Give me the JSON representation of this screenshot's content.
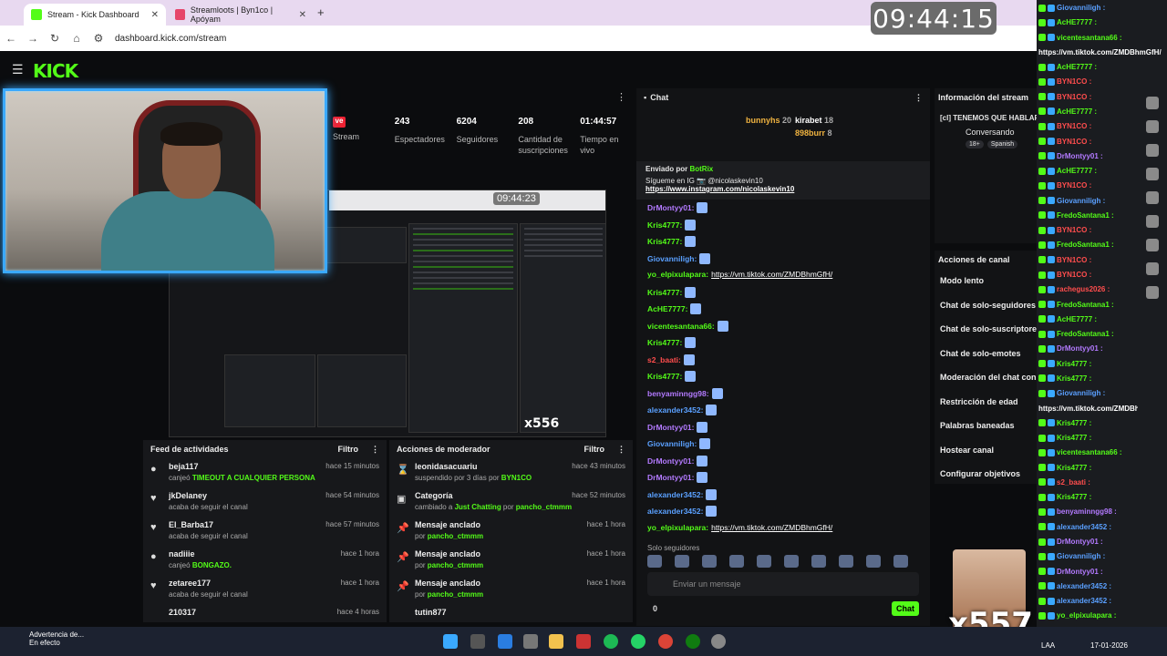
{
  "browser": {
    "tabs": [
      {
        "label": "Stream - Kick Dashboard",
        "active": true
      },
      {
        "label": "Streamloots | Byn1co | Apóyam",
        "active": false
      }
    ],
    "url": "dashboard.kick.com/stream",
    "new_tab": "+"
  },
  "clock": "09:44:15",
  "app": {
    "logo": "KICK"
  },
  "stats": [
    {
      "value": "",
      "label": "Stream",
      "highlight": "ve"
    },
    {
      "value": "243",
      "label": "Espectadores"
    },
    {
      "value": "6204",
      "label": "Seguidores"
    },
    {
      "value": "208",
      "label": "Cantidad de suscripciones"
    },
    {
      "value": "01:44:57",
      "label": "Tiempo en vivo"
    }
  ],
  "preview": {
    "clock": "09:44:23",
    "overlay_count": "x556"
  },
  "feed": {
    "title": "Feed de actividades",
    "filter": "Filtro",
    "items": [
      {
        "name": "beja117",
        "desc": "canjeó",
        "extra": "TIMEOUT A CUALQUIER PERSONA",
        "time": "hace 15 minutos",
        "icon": "redeem"
      },
      {
        "name": "jkDelaney",
        "desc": "acaba de seguir el canal",
        "extra": "",
        "time": "hace 54 minutos",
        "icon": "heart"
      },
      {
        "name": "El_Barba17",
        "desc": "acaba de seguir el canal",
        "extra": "",
        "time": "hace 57 minutos",
        "icon": "heart"
      },
      {
        "name": "nadiiie",
        "desc": "canjeó",
        "extra": "BONGAZO.",
        "time": "hace 1 hora",
        "icon": "redeem"
      },
      {
        "name": "zetaree177",
        "desc": "acaba de seguir el canal",
        "extra": "",
        "time": "hace 1 hora",
        "icon": "heart"
      },
      {
        "name": "210317",
        "desc": "",
        "extra": "",
        "time": "hace 4 horas",
        "icon": "heart"
      }
    ]
  },
  "mod": {
    "title": "Acciones de moderador",
    "filter": "Filtro",
    "items": [
      {
        "name": "leonidasacuariu",
        "desc": "suspendido por 3 días por",
        "extra": "BYN1CO",
        "time": "hace 43 minutos",
        "icon": "hourglass"
      },
      {
        "name": "Categoría",
        "desc": "cambiado a",
        "extra": "Just Chatting",
        "by": "pancho_ctmmm",
        "time": "hace 52 minutos",
        "icon": "folder"
      },
      {
        "name": "Mensaje anclado",
        "desc": "por",
        "extra": "pancho_ctmmm",
        "time": "hace 1 hora",
        "icon": "pin"
      },
      {
        "name": "Mensaje anclado",
        "desc": "por",
        "extra": "pancho_ctmmm",
        "time": "hace 1 hora",
        "icon": "pin"
      },
      {
        "name": "Mensaje anclado",
        "desc": "por",
        "extra": "pancho_ctmmm",
        "time": "hace 1 hora",
        "icon": "pin"
      },
      {
        "name": "tutin877",
        "desc": "",
        "extra": "",
        "time": "",
        "icon": "hourglass"
      }
    ]
  },
  "chat": {
    "title": "Chat",
    "gifters": [
      {
        "name": "bunnyhs",
        "count": "20"
      },
      {
        "name": "kirabet",
        "count": "18"
      },
      {
        "name": "898burr",
        "count": "8"
      }
    ],
    "pinned": {
      "by": "Enviado por",
      "user": "BotRix",
      "text": "Sígueme en IG 📷 @nicolaskevin10",
      "link": "https://www.instagram.com/nicolaskevin10"
    },
    "messages": [
      {
        "user": "DrMontyy01:",
        "color": "#b37aff",
        "text": "",
        "link": ""
      },
      {
        "user": "Kris4777:",
        "color": "#53fc18",
        "text": "",
        "link": ""
      },
      {
        "user": "Kris4777:",
        "color": "#53fc18",
        "text": "",
        "link": ""
      },
      {
        "user": "Giovanniligh:",
        "color": "#5aa0ff",
        "text": "",
        "link": ""
      },
      {
        "user": "yo_elpixulapara:",
        "color": "#53fc18",
        "text": "",
        "link": "https://vm.tiktok.com/ZMDBhmGfH/"
      },
      {
        "user": "Kris4777:",
        "color": "#53fc18",
        "text": "",
        "link": ""
      },
      {
        "user": "AcHE7777:",
        "color": "#53fc18",
        "text": "",
        "link": ""
      },
      {
        "user": "vicentesantana66:",
        "color": "#53fc18",
        "text": "",
        "link": ""
      },
      {
        "user": "Kris4777:",
        "color": "#53fc18",
        "text": "",
        "link": ""
      },
      {
        "user": "s2_baati:",
        "color": "#ff4d4d",
        "text": "",
        "link": ""
      },
      {
        "user": "Kris4777:",
        "color": "#53fc18",
        "text": "",
        "link": ""
      },
      {
        "user": "benyaminngg98:",
        "color": "#b37aff",
        "text": "",
        "link": ""
      },
      {
        "user": "alexander3452:",
        "color": "#5aa0ff",
        "text": "",
        "link": ""
      },
      {
        "user": "DrMontyy01:",
        "color": "#b37aff",
        "text": "",
        "link": ""
      },
      {
        "user": "Giovanniligh:",
        "color": "#5aa0ff",
        "text": "",
        "link": ""
      },
      {
        "user": "DrMontyy01:",
        "color": "#b37aff",
        "text": "",
        "link": ""
      },
      {
        "user": "DrMontyy01:",
        "color": "#b37aff",
        "text": "",
        "link": ""
      },
      {
        "user": "alexander3452:",
        "color": "#5aa0ff",
        "text": "",
        "link": ""
      },
      {
        "user": "alexander3452:",
        "color": "#5aa0ff",
        "text": "",
        "link": ""
      },
      {
        "user": "yo_elpixulapara:",
        "color": "#53fc18",
        "text": "",
        "link": "https://vm.tiktok.com/ZMDBhmGfH/"
      }
    ],
    "solo_label": "Solo seguidores",
    "input_placeholder": "Enviar un mensaje",
    "send_label": "Chat",
    "points": "0"
  },
  "info": {
    "title": "Información del stream",
    "stream_title": "[cl] TENEMOS QUE HABLAR | !ig !casino !ds",
    "category": "Conversando",
    "tags": [
      "18+",
      "Spanish"
    ]
  },
  "actions": {
    "title": "Acciones de canal",
    "items": [
      "Modo lento",
      "Chat de solo-seguidores",
      "Chat de solo-suscriptores",
      "Chat de solo-emotes",
      "Moderación del chat con IA",
      "Restricción de edad",
      "Palabras baneadas",
      "Hostear canal",
      "Configurar objetivos"
    ]
  },
  "overlay_chat": [
    {
      "user": "Giovanniligh :",
      "color": "#5aa0ff"
    },
    {
      "user": "AcHE7777 :",
      "color": "#53fc18"
    },
    {
      "user": "vicentesantana66 :",
      "color": "#53fc18"
    },
    {
      "user": "https://vm.tiktok.com/ZMDBhmGfH/",
      "color": "#ffffff"
    },
    {
      "user": "AcHE7777 :",
      "color": "#53fc18"
    },
    {
      "user": "BYN1CO :",
      "color": "#ff4d4d"
    },
    {
      "user": "BYN1CO :",
      "color": "#ff4d4d"
    },
    {
      "user": "AcHE7777 :",
      "color": "#53fc18"
    },
    {
      "user": "BYN1CO :",
      "color": "#ff4d4d"
    },
    {
      "user": "BYN1CO :",
      "color": "#ff4d4d"
    },
    {
      "user": "DrMontyy01 :",
      "color": "#b37aff"
    },
    {
      "user": "AcHE7777 :",
      "color": "#53fc18"
    },
    {
      "user": "BYN1CO :",
      "color": "#ff4d4d"
    },
    {
      "user": "Giovanniligh :",
      "color": "#5aa0ff"
    },
    {
      "user": "FredoSantana1 :",
      "color": "#53fc18"
    },
    {
      "user": "BYN1CO :",
      "color": "#ff4d4d"
    },
    {
      "user": "FredoSantana1 :",
      "color": "#53fc18"
    },
    {
      "user": "BYN1CO :",
      "color": "#ff4d4d"
    },
    {
      "user": "BYN1CO :",
      "color": "#ff4d4d"
    },
    {
      "user": "rachegus2026 :",
      "color": "#ff4d4d"
    },
    {
      "user": "FredoSantana1 :",
      "color": "#53fc18"
    },
    {
      "user": "AcHE7777 :",
      "color": "#53fc18"
    },
    {
      "user": "FredoSantana1 :",
      "color": "#53fc18"
    },
    {
      "user": "DrMontyy01 :",
      "color": "#b37aff"
    },
    {
      "user": "Kris4777 :",
      "color": "#53fc18"
    },
    {
      "user": "Kris4777 :",
      "color": "#53fc18"
    },
    {
      "user": "Giovanniligh :",
      "color": "#5aa0ff"
    },
    {
      "user": "https://vm.tiktok.com/ZMDBhmGfH/",
      "color": "#ffffff"
    },
    {
      "user": "Kris4777 :",
      "color": "#53fc18"
    },
    {
      "user": "Kris4777 :",
      "color": "#53fc18"
    },
    {
      "user": "vicentesantana66 :",
      "color": "#53fc18"
    },
    {
      "user": "Kris4777 :",
      "color": "#53fc18"
    },
    {
      "user": "s2_baati :",
      "color": "#ff4d4d"
    },
    {
      "user": "Kris4777 :",
      "color": "#53fc18"
    },
    {
      "user": "benyaminngg98 :",
      "color": "#b37aff"
    },
    {
      "user": "alexander3452 :",
      "color": "#5aa0ff"
    },
    {
      "user": "DrMontyy01 :",
      "color": "#b37aff"
    },
    {
      "user": "Giovanniligh :",
      "color": "#5aa0ff"
    },
    {
      "user": "DrMontyy01 :",
      "color": "#b37aff"
    },
    {
      "user": "alexander3452 :",
      "color": "#5aa0ff"
    },
    {
      "user": "alexander3452 :",
      "color": "#5aa0ff"
    },
    {
      "user": "yo_elpixulapara :",
      "color": "#53fc18"
    },
    {
      "user": "https://vm.tiktok.com/ZMDBhmGfH/",
      "color": "#ffffff"
    }
  ],
  "overlay_count": "x557",
  "taskbar": {
    "warning_title": "Advertencia de...",
    "warning_sub": "En efecto",
    "lang": "LAA",
    "date": "17-01-2026"
  },
  "colors": {
    "accent": "#53fc18",
    "bg": "#0b0c0e",
    "panel": "#17181b"
  }
}
